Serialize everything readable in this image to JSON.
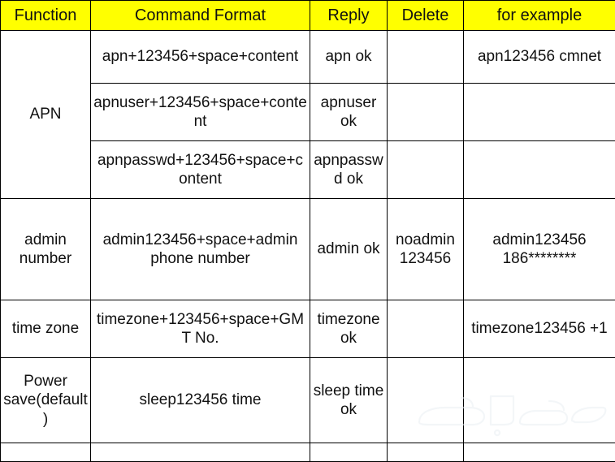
{
  "table": {
    "headers": [
      "Function",
      "Command Format",
      "Reply",
      "Delete",
      "for example"
    ],
    "rows": [
      {
        "function": "APN",
        "function_rowspan": 3,
        "command": "apn+123456+space+content",
        "reply": "apn ok",
        "delete": "",
        "example": "apn123456 cmnet"
      },
      {
        "command": "apnuser+123456+space+content",
        "reply": "apnuser ok",
        "delete": "",
        "example": ""
      },
      {
        "command": "apnpasswd+123456+space+content",
        "reply": "apnpasswd ok",
        "delete": "",
        "example": ""
      },
      {
        "function": "admin number",
        "command": "admin123456+space+admin phone number",
        "reply": "admin ok",
        "delete": "noadmin 123456",
        "example": "admin123456 186********"
      },
      {
        "function": "time zone",
        "command": "timezone+123456+space+GMT No.",
        "reply": "timezone ok",
        "delete": "",
        "example": "timezone123456 +1"
      },
      {
        "function": "Power save(default)",
        "command": "sleep123456 time",
        "reply": "sleep time ok",
        "delete": "",
        "example": ""
      },
      {
        "function": "",
        "command": "",
        "reply": "",
        "delete": "",
        "example": ""
      }
    ]
  },
  "watermark": {
    "name": "arabic-watermark",
    "text": "حراج"
  },
  "colors": {
    "header_background": "#ffff00",
    "function_column_background": "#dce6f1",
    "cell_background": "#ffffff",
    "border": "#000000",
    "text": "#111111"
  }
}
